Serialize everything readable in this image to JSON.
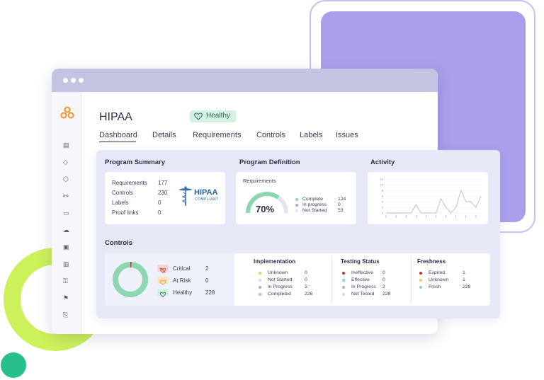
{
  "app": {
    "title": "HIPAA",
    "status_badge": "Healthy",
    "tabs": [
      "Dashboard",
      "Details",
      "Requirements",
      "Controls",
      "Labels",
      "Issues"
    ],
    "active_tab": "Dashboard"
  },
  "colors": {
    "accent_orange": "#f0932b",
    "healthy_green": "#8dd6b2",
    "critical_red": "#c0392b",
    "at_risk_yellow": "#f6c768",
    "in_progress_purple": "#b3a3e6",
    "gray": "#d8d8e4"
  },
  "sidebar_icons": [
    "logo-icon",
    "dashboard-icon",
    "box-icon",
    "shield-icon",
    "workflow-icon",
    "document-icon",
    "cloud-icon",
    "image-icon",
    "clipboard-icon",
    "key-icon",
    "flag-icon",
    "export-icon"
  ],
  "program_summary": {
    "title": "Program Summary",
    "rows": [
      {
        "label": "Requirements",
        "value": "177"
      },
      {
        "label": "Controls",
        "value": "230"
      },
      {
        "label": "Labels",
        "value": "0"
      },
      {
        "label": "Proof links",
        "value": "0"
      }
    ],
    "logo": {
      "name": "HIPAA",
      "sub": "COMPLIANT"
    }
  },
  "program_definition": {
    "title": "Program Definition",
    "subtitle": "Requirements",
    "percent": 70,
    "percent_label": "70%",
    "legend": [
      {
        "label": "Complete",
        "value": "124",
        "color": "#8dd6b2"
      },
      {
        "label": "In progress",
        "value": "0",
        "color": "#b3a3e6"
      },
      {
        "label": "Not Started",
        "value": "53",
        "color": "#e4e4ee"
      }
    ]
  },
  "activity": {
    "title": "Activity",
    "chart_data": {
      "type": "line",
      "y_ticks": [
        "0",
        "2",
        "4",
        "6",
        "8",
        "10",
        "12"
      ],
      "ylim": [
        0,
        12
      ],
      "values": [
        0,
        0,
        0,
        0,
        0,
        0,
        3,
        0,
        0,
        0,
        0,
        5,
        2,
        0,
        2,
        8,
        4,
        4,
        2,
        6
      ]
    }
  },
  "controls": {
    "title": "Controls",
    "donut": {
      "healthy": 228,
      "critical": 2,
      "at_risk": 0
    },
    "status": [
      {
        "label": "Critical",
        "value": "2",
        "icon": "critical-icon"
      },
      {
        "label": "At Risk",
        "value": "0",
        "icon": "at-risk-icon"
      },
      {
        "label": "Healthy",
        "value": "228",
        "icon": "healthy-icon"
      }
    ],
    "implementation": {
      "title": "Implementation",
      "items": [
        {
          "label": "Unknown",
          "value": "0",
          "color": "#f6c768"
        },
        {
          "label": "Not Started",
          "value": "0",
          "color": "#d8d8e4"
        },
        {
          "label": "In Progress",
          "value": "2",
          "color": "#b3a3e6"
        },
        {
          "label": "Completed",
          "value": "228",
          "color": "#8dd6b2"
        }
      ]
    },
    "testing": {
      "title": "Testing Status",
      "items": [
        {
          "label": "Ineffective",
          "value": "0",
          "color": "#c0392b"
        },
        {
          "label": "Effective",
          "value": "0",
          "color": "#8dd6b2"
        },
        {
          "label": "In Progress",
          "value": "2",
          "color": "#b3a3e6"
        },
        {
          "label": "Not Tested",
          "value": "228",
          "color": "#d8d8e4"
        }
      ]
    },
    "freshness": {
      "title": "Freshness",
      "items": [
        {
          "label": "Expired",
          "value": "1",
          "color": "#c0392b"
        },
        {
          "label": "Unknown",
          "value": "1",
          "color": "#f6c768"
        },
        {
          "label": "Fresh",
          "value": "228",
          "color": "#8dd6b2"
        }
      ]
    }
  }
}
